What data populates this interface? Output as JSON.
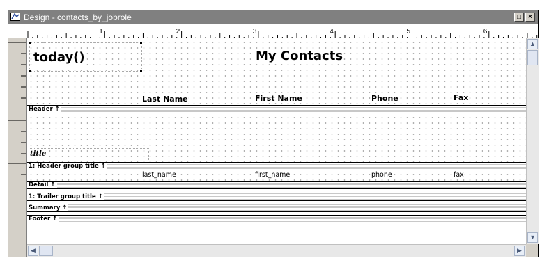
{
  "window": {
    "title": "Design - contacts_by_jobrole",
    "maximize_glyph": "□",
    "close_glyph": "×"
  },
  "ruler": {
    "inch_labels": [
      "1",
      "2",
      "3",
      "4",
      "5",
      "6"
    ]
  },
  "header_band": {
    "today_text": "today()",
    "report_title": "My Contacts",
    "column_headers": {
      "last_name": "Last Name",
      "first_name": "First Name",
      "phone": "Phone",
      "fax": "Fax"
    },
    "label": "Header ↑"
  },
  "group_header_band": {
    "title_field": "title",
    "label": "1: Header group title ↑"
  },
  "detail_band": {
    "columns": {
      "last_name": "last_name",
      "first_name": "first_name",
      "phone": "phone",
      "fax": "fax"
    },
    "label": "Detail ↑"
  },
  "trailer_band": {
    "label": "1: Trailer group title ↑"
  },
  "summary_band": {
    "label": "Summary ↑"
  },
  "footer_band": {
    "label": "Footer ↑"
  },
  "scrollbars": {
    "up_glyph": "▲",
    "down_glyph": "▼",
    "left_glyph": "◀",
    "right_glyph": "▶"
  }
}
